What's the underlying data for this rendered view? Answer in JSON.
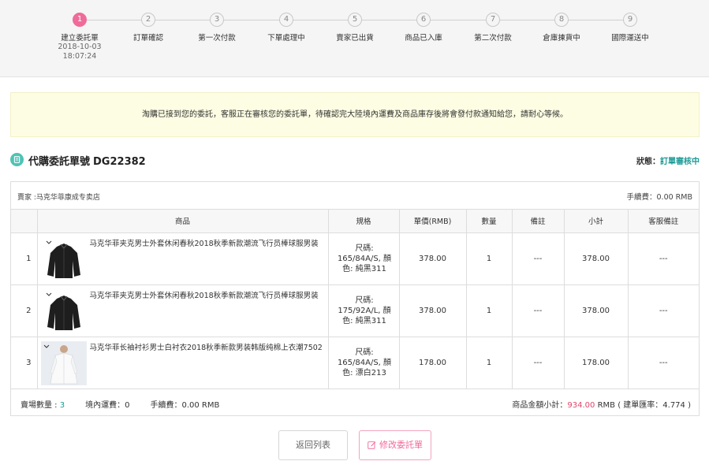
{
  "steps": [
    {
      "num": "1",
      "label": "建立委託單",
      "date": "2018-10-03",
      "time": "18:07:24",
      "active": true
    },
    {
      "num": "2",
      "label": "訂單確認"
    },
    {
      "num": "3",
      "label": "第一次付款"
    },
    {
      "num": "4",
      "label": "下單處理中"
    },
    {
      "num": "5",
      "label": "賣家已出貨"
    },
    {
      "num": "6",
      "label": "商品已入庫"
    },
    {
      "num": "7",
      "label": "第二次付款"
    },
    {
      "num": "8",
      "label": "倉庫揀貨中"
    },
    {
      "num": "9",
      "label": "國際運送中"
    }
  ],
  "notice": "淘購已接到您的委託，客服正在審核您的委託單，待確認完大陸境內運費及商品庫存後將會發付款通知給您，請耐心等候。",
  "order": {
    "title": "代購委託單號",
    "number": "DG22382",
    "status_label": "狀態：",
    "status_value": "訂單審核中"
  },
  "seller": {
    "label": "賣家 :马克华菲康成专卖店",
    "fee": "手續費：0.00 RMB"
  },
  "table": {
    "headers": [
      "",
      "商品",
      "規格",
      "單價(RMB)",
      "數量",
      "備註",
      "小計",
      "客服備註"
    ],
    "rows": [
      {
        "idx": "1",
        "name": "马克华菲夹克男士外套休闲春秋2018秋季新款潮流飞行员棒球服男装",
        "spec": "尺碼: 165/84A/S, 顏色: 純黑311",
        "price": "378.00",
        "qty": "1",
        "note": "---",
        "subtotal": "378.00",
        "cs_note": "---",
        "thumb": "jacket-thumbnail"
      },
      {
        "idx": "2",
        "name": "马克华菲夹克男士外套休闲春秋2018秋季新款潮流飞行员棒球服男装",
        "spec": "尺碼: 175/92A/L, 顏色: 純黑311",
        "price": "378.00",
        "qty": "1",
        "note": "---",
        "subtotal": "378.00",
        "cs_note": "---",
        "thumb": "jacket-thumbnail"
      },
      {
        "idx": "3",
        "name": "马克华菲长袖衬衫男士白衬衣2018秋季新款男装韩版纯棉上衣潮7502",
        "spec": "尺碼: 165/84A/S, 顏色: 漂白213",
        "price": "178.00",
        "qty": "1",
        "note": "---",
        "subtotal": "178.00",
        "cs_note": "---",
        "thumb": "shirt-thumbnail"
      }
    ]
  },
  "summary": {
    "count_label": "賣場數量 : ",
    "count_value": "3",
    "domestic_shipping": "境內運費：0",
    "fee": "手續費：0.00 RMB",
    "subtotal_label": "商品金額小計：",
    "subtotal_value": "934.00",
    "subtotal_suffix": " RMB ( 建單匯率：4.774 )"
  },
  "buttons": {
    "back": "返回列表",
    "edit": "修改委託單"
  },
  "colors": {
    "accent_pink": "#f06a9a",
    "teal": "#1a9a96",
    "price_red": "#e0466b",
    "notice_bg": "#fdfde3"
  }
}
